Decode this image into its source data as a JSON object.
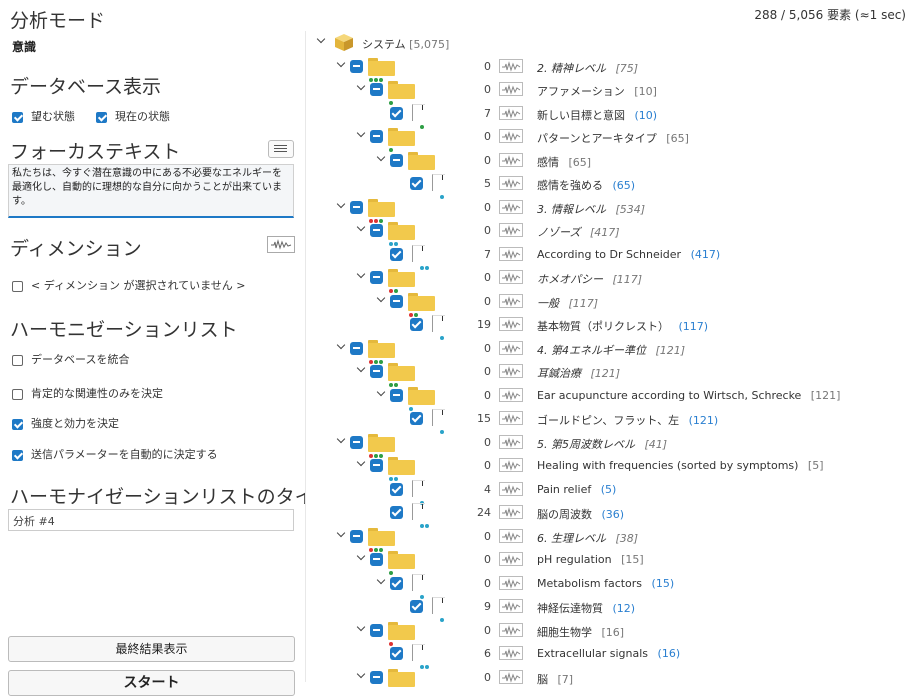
{
  "left_panel": {
    "analysis_mode_heading": "分析モード",
    "analysis_mode_value": "意識",
    "database_display_heading": "データベース表示",
    "display_options": [
      {
        "label": "望む状態",
        "checked": true
      },
      {
        "label": "現在の状態",
        "checked": true
      }
    ],
    "focus_text_heading": "フォーカステキスト",
    "focus_text_value": "私たちは、今すぐ潜在意識の中にある不必要なエネルギーを最適化し、自動的に理想的な自分に向かうことが出来ています。",
    "dimension_heading": "ディメンション",
    "dimension_option": {
      "label": "< ディメンション が選択されていません >",
      "checked": false
    },
    "harmonization_list_heading": "ハーモニゼーションリスト",
    "harmonization_options": [
      {
        "label": "データベースを統合",
        "checked": false
      },
      {
        "label": "肯定的な関連性のみを決定",
        "checked": false
      },
      {
        "label": "強度と効力を決定",
        "checked": true
      },
      {
        "label": "送信パラメーターを自動的に決定する",
        "checked": true
      }
    ],
    "list_title_heading": "ハーモナイゼーションリストのタイトル",
    "list_title_value": "分析 #4",
    "show_results_button": "最終結果表示",
    "start_button": "スタート"
  },
  "header": {
    "element_counter": "288 / 5,056 要素 (≈1 sec)"
  },
  "tree": {
    "root": {
      "label": "システム",
      "count": "[5,075]"
    },
    "rows": [
      {
        "value": "0",
        "label": "2. 精神レベル",
        "count": "[75]",
        "italic": true,
        "type": "folder",
        "dots": [
          "#2e9e44",
          "#2e9e44",
          "#2e9e44"
        ]
      },
      {
        "value": "0",
        "label": "アファメーション",
        "count": "[10]",
        "type": "folder",
        "dots": [
          "#2e9e44"
        ]
      },
      {
        "value": "7",
        "label": "新しい目標と意図",
        "count": "(10)",
        "type": "doc",
        "dots": [
          "#2e9e44"
        ]
      },
      {
        "value": "0",
        "label": "パターンとアーキタイプ",
        "count": "[65]",
        "type": "folder",
        "dots": [
          "#2e9e44"
        ]
      },
      {
        "value": "0",
        "label": "感情",
        "count": "[65]",
        "type": "folder",
        "dots": []
      },
      {
        "value": "5",
        "label": "感情を強める",
        "count": "(65)",
        "type": "doc",
        "dots": [
          "#2aa3c9"
        ]
      },
      {
        "value": "0",
        "label": "3. 情報レベル",
        "count": "[534]",
        "italic": true,
        "type": "folder",
        "dots": [
          "#d33",
          "#d33",
          "#2e9e44"
        ]
      },
      {
        "value": "0",
        "label": "ノゾーズ",
        "count": "[417]",
        "italic": true,
        "type": "folder",
        "dots": [
          "#2aa3c9",
          "#2aa3c9"
        ]
      },
      {
        "value": "7",
        "label": "According to Dr Schneider",
        "count": "(417)",
        "type": "doc",
        "dots": [
          "#2aa3c9",
          "#2aa3c9"
        ]
      },
      {
        "value": "0",
        "label": "ホメオパシー",
        "count": "[117]",
        "italic": true,
        "type": "folder",
        "dots": [
          "#d33",
          "#2e9e44"
        ]
      },
      {
        "value": "0",
        "label": "一般",
        "count": "[117]",
        "italic": true,
        "type": "folder",
        "dots": [
          "#d33",
          "#2e9e44"
        ]
      },
      {
        "value": "19",
        "label": "基本物質（ポリクレスト）",
        "count": "(117)",
        "type": "doc",
        "dots": [
          "#2aa3c9"
        ]
      },
      {
        "value": "0",
        "label": "4. 第4エネルギー準位",
        "count": "[121]",
        "italic": true,
        "type": "folder",
        "dots": [
          "#d33",
          "#2e9e44",
          "#2e9e44"
        ]
      },
      {
        "value": "0",
        "label": "耳鍼治療",
        "count": "[121]",
        "italic": true,
        "type": "folder",
        "dots": [
          "#2e9e44",
          "#2e9e44"
        ]
      },
      {
        "value": "0",
        "label": "Ear acupuncture according to Wirtsch, Schrecke",
        "count": "[121]",
        "type": "folder",
        "dots": [
          "#2aa3c9"
        ]
      },
      {
        "value": "15",
        "label": "ゴールドピン、フラット、左",
        "count": "(121)",
        "type": "doc",
        "dots": [
          "#2aa3c9"
        ]
      },
      {
        "value": "0",
        "label": "5. 第5周波数レベル",
        "count": "[41]",
        "italic": true,
        "type": "folder",
        "dots": [
          "#d33",
          "#2e9e44",
          "#2e9e44"
        ]
      },
      {
        "value": "0",
        "label": "Healing with frequencies (sorted by symptoms)",
        "count": "[5]",
        "type": "folder",
        "dots": [
          "#2aa3c9",
          "#2aa3c9"
        ]
      },
      {
        "value": "4",
        "label": "Pain relief",
        "count": "(5)",
        "type": "doc",
        "dots": [
          "#2aa3c9"
        ]
      },
      {
        "value": "24",
        "label": "脳の周波数",
        "count": "(36)",
        "type": "doc",
        "dots": [
          "#2aa3c9",
          "#2aa3c9"
        ]
      },
      {
        "value": "0",
        "label": "6. 生理レベル",
        "count": "[38]",
        "italic": true,
        "type": "folder",
        "dots": [
          "#d33",
          "#2e9e44",
          "#2e9e44"
        ]
      },
      {
        "value": "0",
        "label": "pH regulation",
        "count": "[15]",
        "type": "folder",
        "dots": [
          "#2e9e44"
        ]
      },
      {
        "value": "0",
        "label": "Metabolism factors",
        "count": "(15)",
        "type": "doc",
        "dots": [
          "#2aa3c9"
        ]
      },
      {
        "value": "9",
        "label": "神経伝達物質",
        "count": "(12)",
        "type": "doc",
        "dots": [
          "#2aa3c9"
        ]
      },
      {
        "value": "0",
        "label": "細胞生物学",
        "count": "[16]",
        "type": "folder",
        "dots": [
          "#d33"
        ]
      },
      {
        "value": "6",
        "label": "Extracellular signals",
        "count": "(16)",
        "type": "doc",
        "dots": [
          "#2aa3c9",
          "#2aa3c9"
        ]
      },
      {
        "value": "0",
        "label": "脳",
        "count": "[7]",
        "type": "folder",
        "dots": []
      }
    ]
  },
  "colors": {
    "accent": "#1e79c6",
    "folder": "#f2c94c",
    "count_blue": "#2a7fd0"
  }
}
